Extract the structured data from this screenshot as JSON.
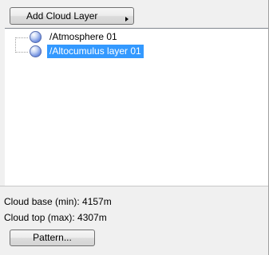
{
  "toolbar": {
    "add_cloud_layer_label": "Add Cloud Layer"
  },
  "tree": {
    "items": [
      {
        "label": "/Atmosphere 01",
        "icon": "globe-icon",
        "selected": false
      },
      {
        "label": "/Altocumulus layer 01",
        "icon": "globe-icon",
        "selected": true
      }
    ],
    "selection_color": "#3399ff"
  },
  "info": {
    "cloud_base": "Cloud base (min): 4157m",
    "cloud_top": "Cloud top (max): 4307m"
  },
  "buttons": {
    "pattern_label": "Pattern..."
  }
}
